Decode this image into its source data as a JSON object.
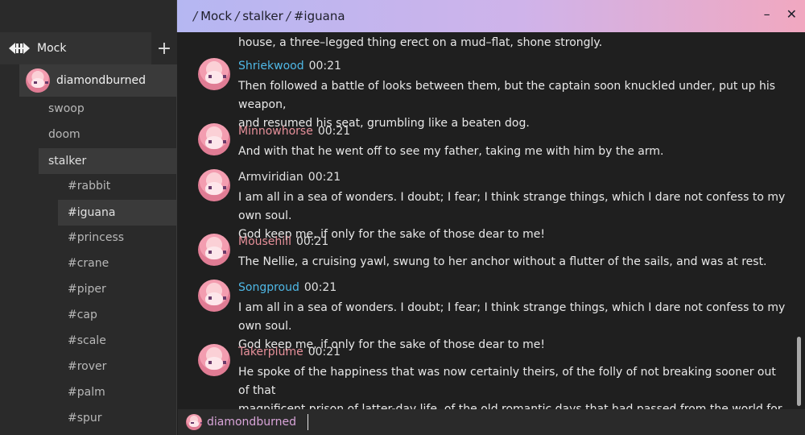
{
  "header": {
    "path": [
      "Mock",
      "stalker",
      "#iguana"
    ],
    "minimize_icon": "minimize-icon",
    "close_icon": "close-icon"
  },
  "sidebar": {
    "brand": "Mock",
    "add_icon": "+",
    "account": "diamondburned",
    "users": [
      {
        "label": "swoop"
      },
      {
        "label": "doom"
      },
      {
        "label": "stalker",
        "active": true
      }
    ],
    "channels": [
      {
        "label": "#rabbit"
      },
      {
        "label": "#iguana",
        "active": true
      },
      {
        "label": "#princess"
      },
      {
        "label": "#crane"
      },
      {
        "label": "#piper"
      },
      {
        "label": "#cap"
      },
      {
        "label": "#scale"
      },
      {
        "label": "#rover"
      },
      {
        "label": "#palm"
      },
      {
        "label": "#spur"
      }
    ]
  },
  "messages": {
    "partial": "house, a three–legged thing erect on a mud–flat, shone strongly.",
    "items": [
      {
        "author": "Shriekwood",
        "time": "00:21",
        "color": "#4fb8e6",
        "lines": [
          "Then followed a battle of looks between them, but the captain soon knuckled under, put up his weapon,",
          "and resumed his seat, grumbling like a beaten dog."
        ]
      },
      {
        "author": "Minnowhorse",
        "time": "00:21",
        "color": "#e6909a",
        "lines": [
          "And with that he went off to see my father, taking me with him by the arm."
        ]
      },
      {
        "author": "Armviridian",
        "time": "00:21",
        "color": "#e0e0e0",
        "lines": [
          "I am all in a sea of wonders. I doubt; I fear; I think strange things, which I dare not confess to my own soul.",
          "God keep me, if only for the sake of those dear to me!"
        ]
      },
      {
        "author": "Mousehill",
        "time": "00:21",
        "color": "#e6909a",
        "lines": [
          "The Nellie, a cruising yawl, swung to her anchor without a flutter of the sails, and was at rest."
        ]
      },
      {
        "author": "Songproud",
        "time": "00:21",
        "color": "#4fb8e6",
        "lines": [
          "I am all in a sea of wonders. I doubt; I fear; I think strange things, which I dare not confess to my own soul.",
          "God keep me, if only for the sake of those dear to me!"
        ]
      },
      {
        "author": "Takerplume",
        "time": "00:21",
        "color": "#e6909a",
        "lines": [
          "He spoke of the happiness that was now certainly theirs, of the folly of not breaking sooner out of that",
          "magnificent prison of latter-day life, of the old romantic days that had passed from the world for ever."
        ]
      }
    ]
  },
  "composer": {
    "nick": "diamondburned",
    "value": ""
  }
}
